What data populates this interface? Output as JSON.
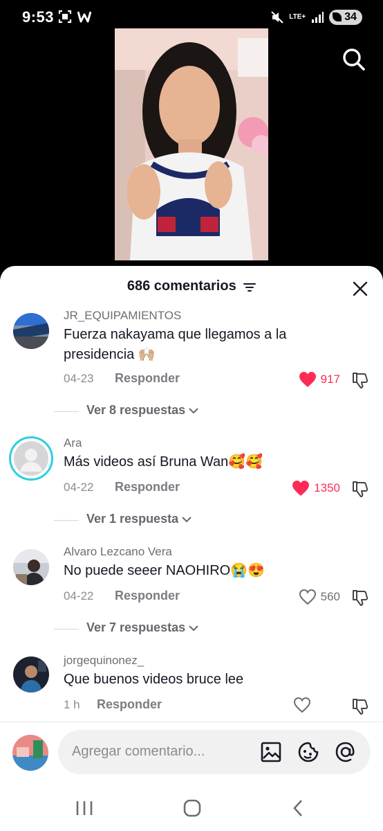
{
  "status_bar": {
    "time": "9:53",
    "network": "LTE+",
    "battery": "34"
  },
  "sheet": {
    "title": "686 comentarios"
  },
  "comments": [
    {
      "user": "JR_EQUIPAMIENTOS",
      "text": "Fuerza nakayama que llegamos a la presidencia 🙌🏼",
      "date": "04-23",
      "reply_label": "Responder",
      "likes": "917",
      "liked": true,
      "replies": "Ver 8 respuestas"
    },
    {
      "user": "Ara",
      "text": "Más videos así Bruna Wan🥰🥰",
      "date": "04-22",
      "reply_label": "Responder",
      "likes": "1350",
      "liked": true,
      "replies": "Ver 1 respuesta"
    },
    {
      "user": "Alvaro Lezcano Vera",
      "text": "No puede seeer NAOHIRO😭😍",
      "date": "04-22",
      "reply_label": "Responder",
      "likes": "560",
      "liked": false,
      "replies": "Ver 7 respuestas"
    },
    {
      "user": "jorgequinonez_",
      "text": "Que buenos videos bruce lee",
      "date": "1 h",
      "reply_label": "Responder",
      "likes": "",
      "liked": false
    }
  ],
  "input": {
    "placeholder": "Agregar comentario..."
  },
  "colors": {
    "like_red": "#fe2c55",
    "text_dark": "#161823",
    "muted": "#8a8b91"
  }
}
